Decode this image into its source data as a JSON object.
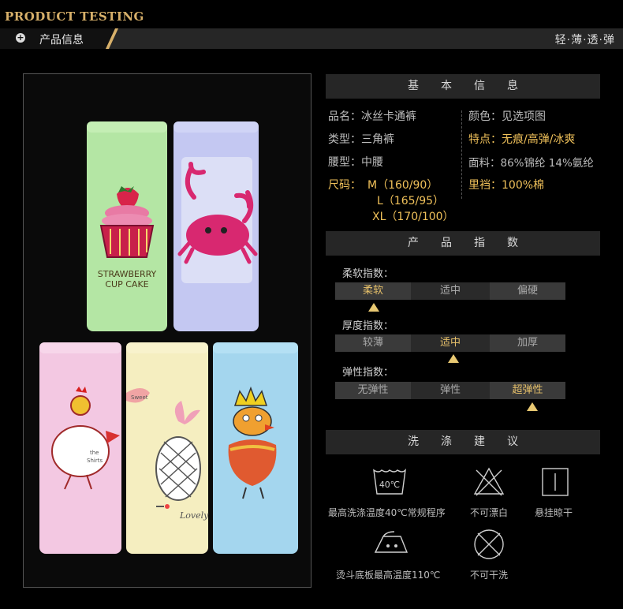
{
  "header": {
    "brand": "PRODUCT TESTING",
    "section_title": "产品信息",
    "slogan": "轻·薄·透·弹"
  },
  "basic_info": {
    "heading": "基本信息",
    "name": "品名：冰丝卡通裤",
    "type": "类型：三角裤",
    "waist": "腰型：中腰",
    "size_label": "尺码：",
    "size_m": "M（160/90）",
    "size_l": "L（165/95）",
    "size_xl": "XL（170/100）",
    "color": "颜色：见选项图",
    "features": "特点：无痕/高弹/冰爽",
    "fabric": "面料：86%锦纶 14%氨纶",
    "lining": "里裆：100%棉"
  },
  "indices": {
    "heading": "产品指数",
    "softness": {
      "label": "柔软指数：",
      "options": [
        "柔软",
        "适中",
        "偏硬"
      ],
      "selected": 0
    },
    "thickness": {
      "label": "厚度指数：",
      "options": [
        "较薄",
        "适中",
        "加厚"
      ],
      "selected": 1
    },
    "elasticity": {
      "label": "弹性指数：",
      "options": [
        "无弹性",
        "弹性",
        "超弹性"
      ],
      "selected": 2
    }
  },
  "care": {
    "heading": "洗涤建议",
    "wash_temp_symbol": "40℃",
    "wash": "最高洗涤温度40℃常规程序",
    "no_bleach": "不可漂白",
    "hang_dry": "悬挂晾干",
    "iron": "烫斗底板最高温度110℃",
    "no_dryclean": "不可干洗"
  },
  "product_photo": {
    "tube1_text_line1": "STRAWBERRY",
    "tube1_text_line2": "CUP CAKE",
    "tube4_text_line1": "the",
    "tube4_text_line2": "Shirts",
    "tube5_text": "Lovely",
    "tube5_leaf_text": "Sweet",
    "colors": {
      "green": "#b4e6a4",
      "lavender": "#c4c8f2",
      "pink": "#f3c8e2",
      "cream": "#f5eec0",
      "blue": "#a4d6ee"
    }
  }
}
